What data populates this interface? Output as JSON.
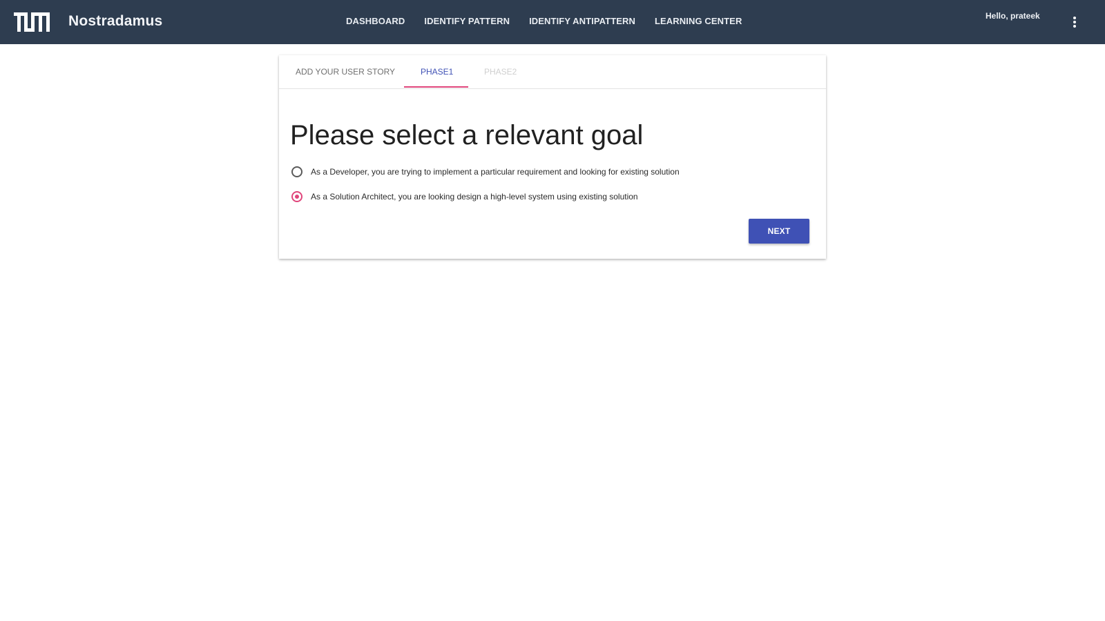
{
  "header": {
    "app_title": "Nostradamus",
    "logo_icon": "tum-logo-icon",
    "nav": [
      {
        "label": "DASHBOARD"
      },
      {
        "label": "IDENTIFY PATTERN"
      },
      {
        "label": "IDENTIFY ANTIPATTERN"
      },
      {
        "label": "LEARNING CENTER"
      }
    ],
    "greeting": "Hello, prateek",
    "menu_icon": "more-vert-icon",
    "background_color": "#2e3d50"
  },
  "card": {
    "tabs": [
      {
        "label": "ADD YOUR USER STORY",
        "state": "normal"
      },
      {
        "label": "PHASE1",
        "state": "active"
      },
      {
        "label": "PHASE2",
        "state": "disabled"
      }
    ],
    "heading": "Please select a relevant goal",
    "options": [
      {
        "label": "As a Developer, you are trying to implement a particular requirement and looking for existing solution",
        "checked": false
      },
      {
        "label": "As a Solution Architect, you are looking design a high-level system using existing solution",
        "checked": true
      }
    ],
    "next_label": "NEXT"
  },
  "colors": {
    "primary": "#3f51b5",
    "accent": "#e0457b"
  }
}
